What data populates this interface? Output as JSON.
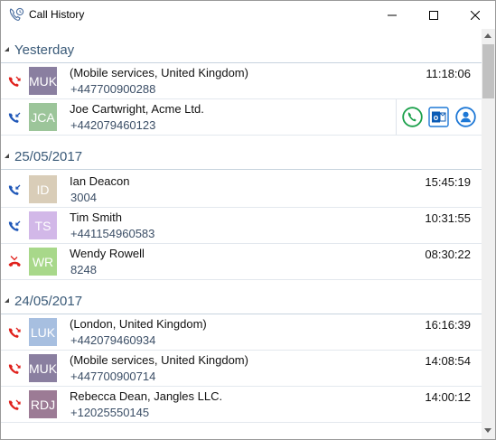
{
  "window": {
    "title": "Call History",
    "icon": "phone-history-icon",
    "controls": [
      "minimize-icon",
      "maximize-icon",
      "close-icon"
    ]
  },
  "groups": [
    {
      "label": "Yesterday",
      "calls": [
        {
          "direction": "missed-incoming",
          "initials": "MUK",
          "avatar_color": "#8a7fa0",
          "name": "(Mobile services, United Kingdom)",
          "number": "+447700900288",
          "time": "11:18:06"
        },
        {
          "direction": "incoming",
          "initials": "JCA",
          "avatar_color": "#9cc59a",
          "name": "Joe Cartwright, Acme Ltd.",
          "number": "+442079460123",
          "time": "",
          "actions": [
            "call-icon",
            "outlook-icon",
            "contact-icon"
          ]
        }
      ]
    },
    {
      "label": "25/05/2017",
      "calls": [
        {
          "direction": "incoming",
          "initials": "ID",
          "avatar_color": "#d9cdb8",
          "name": "Ian Deacon",
          "number": "3004",
          "time": "15:45:19"
        },
        {
          "direction": "incoming",
          "initials": "TS",
          "avatar_color": "#d2b8e8",
          "name": "Tim Smith",
          "number": "+441154960583",
          "time": "10:31:55"
        },
        {
          "direction": "rejected",
          "initials": "WR",
          "avatar_color": "#a8d88a",
          "name": "Wendy Rowell",
          "number": "8248",
          "time": "08:30:22"
        }
      ]
    },
    {
      "label": "24/05/2017",
      "calls": [
        {
          "direction": "missed-incoming",
          "initials": "LUK",
          "avatar_color": "#a7bfe0",
          "name": "(London, United Kingdom)",
          "number": "+442079460934",
          "time": "16:16:39"
        },
        {
          "direction": "missed-incoming",
          "initials": "MUK",
          "avatar_color": "#8a7fa0",
          "name": "(Mobile services, United Kingdom)",
          "number": "+447700900714",
          "time": "14:08:54"
        },
        {
          "direction": "missed-incoming",
          "initials": "RDJ",
          "avatar_color": "#9c7b95",
          "name": "Rebecca Dean, Jangles LLC.",
          "number": "+12025550145",
          "time": "14:00:12"
        }
      ]
    }
  ],
  "colors": {
    "missed": "#e0201b",
    "incoming": "#1f57b8",
    "group_header_text": "#3a5a78",
    "call_action": "#1aa04a",
    "contact_action": "#1e78d6"
  }
}
